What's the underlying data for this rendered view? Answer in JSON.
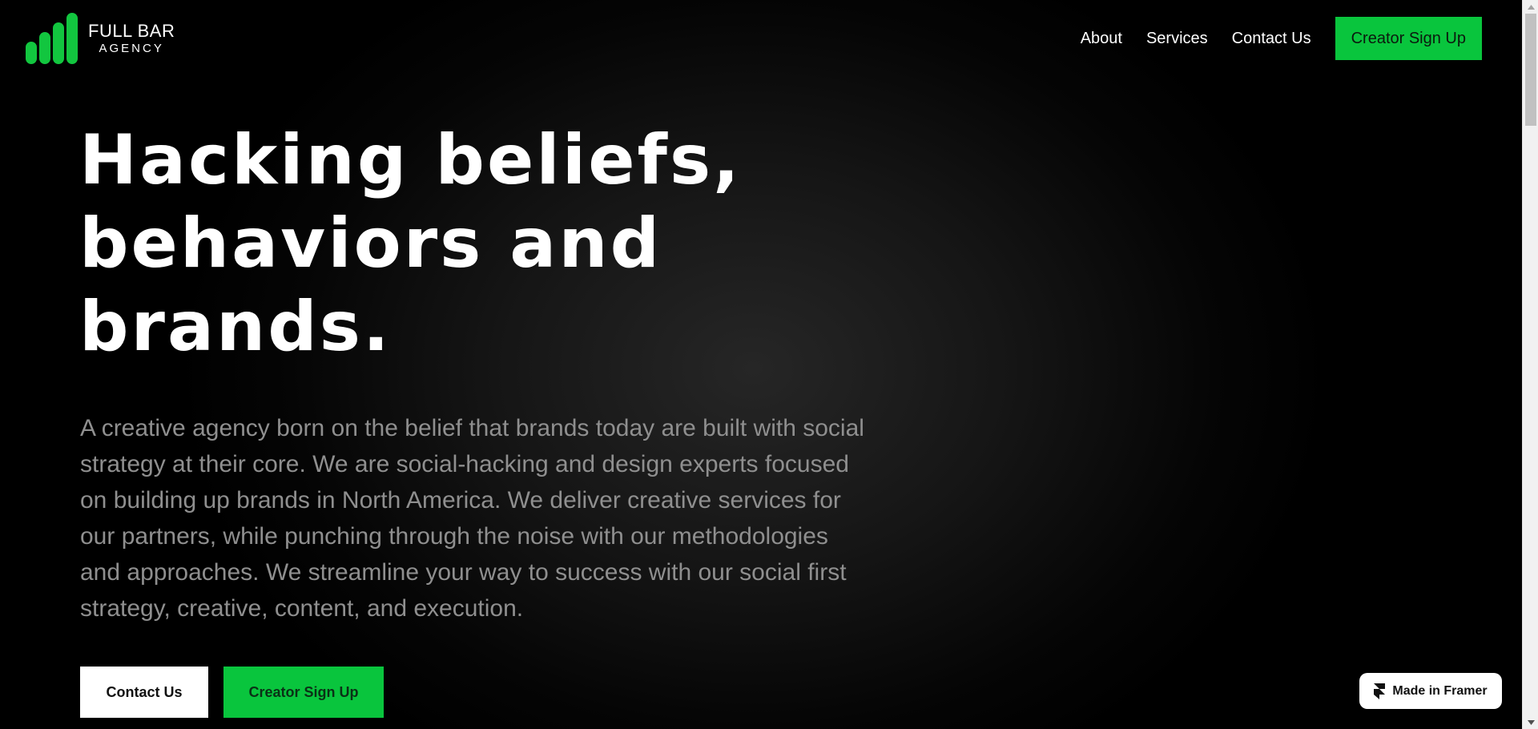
{
  "logo": {
    "line1": "FULL BAR",
    "line2": "AGENCY"
  },
  "nav": {
    "items": [
      "About",
      "Services",
      "Contact Us"
    ],
    "signup_label": "Creator Sign Up"
  },
  "hero": {
    "headline_lines": [
      "Hacking beliefs,",
      "behaviors and",
      "brands."
    ],
    "description": "A creative agency born on the belief that brands today are built with social strategy at their core. We are social-hacking and design experts focused on building up brands in North America. We deliver creative services for our partners, while punching through the noise with our methodologies and approaches. We streamline your way to success with our social first strategy, creative, content, and execution.",
    "contact_label": "Contact Us",
    "signup_label": "Creator Sign Up"
  },
  "badge": {
    "label": "Made in Framer",
    "icon": "framer-icon"
  },
  "colors": {
    "accent": "#09c53d",
    "background": "#000000",
    "text": "#ffffff",
    "muted_text": "#8f8f8f"
  }
}
